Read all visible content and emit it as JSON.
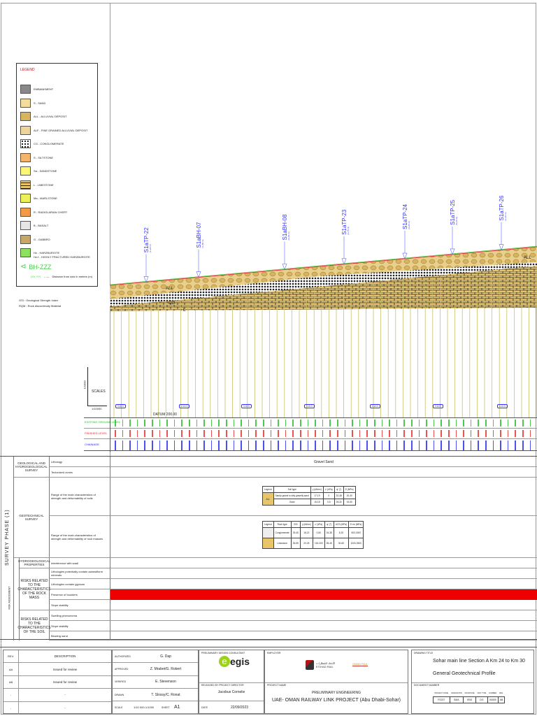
{
  "legend": {
    "title": "LEGEND",
    "items": [
      {
        "label": "EMBANKMENT",
        "color": "#888"
      },
      {
        "label": "S - SAND",
        "color": "#f3dc9c"
      },
      {
        "label": "ALL - ALLUVIAL DEPOSIT",
        "color": "#d9b45e"
      },
      {
        "label": "ALF - FINE GRAINED ALLUVIAL DEPOSIT",
        "color": "#ecd49a"
      },
      {
        "label": "CG - CONGLOMERATE",
        "color": "#ffffff"
      },
      {
        "label": "S - SILTSTONE",
        "color": "#f6b36b"
      },
      {
        "label": "Sa - SANDSTONE",
        "color": "#fbf774"
      },
      {
        "label": "L - LIMESTONE",
        "color": "#e8c56a"
      },
      {
        "label": "Ma - MARLSTONE",
        "color": "#eef05a"
      },
      {
        "label": "R - RADIOLARIAN CHERT",
        "color": "#f39a4a"
      },
      {
        "label": "B - BASALT",
        "color": "#e6e6e6"
      },
      {
        "label": "G - GABBRO",
        "color": "#c8a666"
      },
      {
        "label": "Hz - HARZBURGITE",
        "label2": "Hz-f - HIGHLY FRACTURED HARZBURGITE",
        "color": "#8ee060"
      }
    ],
    "bh_symbol": "BH-ZZZ",
    "bh_note": "Distance from axis in meters (m)",
    "bh_sub": "(XX,YY)",
    "abbr": [
      "GSI : Geological Strength Index",
      "RQM : Rock discontinuity Material"
    ]
  },
  "boreholes": [
    {
      "name": "S1aTP-22",
      "chain": "(1+20 m)"
    },
    {
      "name": "S1aBH-07",
      "chain": "(1+50 m)"
    },
    {
      "name": "S1aBH-08",
      "chain": "(2+60 m)"
    },
    {
      "name": "S1aTP-23",
      "chain": "(3+75 m)"
    },
    {
      "name": "S1aTP-24",
      "chain": "(4+65 m)"
    },
    {
      "name": "S1aTP-25",
      "chain": "(5+40 m)"
    },
    {
      "name": "S1aTP-26",
      "chain": "(6+10 m)"
    }
  ],
  "layer_tags": [
    "ALL",
    "CG",
    "L",
    "ALL"
  ],
  "scales": {
    "label": "SCALES",
    "h": "1/10000",
    "v": "1/1000"
  },
  "datum": "DATUM 200.00",
  "va_label": "V.A.G",
  "bands": {
    "existing": "EXISTING GROUND LEVEL",
    "finished": "FINISHED LEVEL",
    "chainage": "CHAINAGE"
  },
  "table": {
    "phase": "SURVEY PHASE (1)",
    "risk": "RISK ASSESSMENT",
    "groups": [
      "GEOLOGICAL AND HYDROGEOLOGICAL SURVEY",
      "GEOTECHNICAL SURVEY",
      "HYDROGEOLOGICAL PROPERTIES",
      "RISKS RELATED TO THE CHARACTERISTICS OF THE ROCK MASS",
      "RISKS RELATED TO THE CHARACTERISTICS OF THE SOIL"
    ],
    "rows": [
      "Lithology",
      "Tectonized zones",
      "Range of the main characteristics of strength and deformability of soils",
      "Range of the main characteristics of strength and deformability of rock masses",
      "Interference with wadi",
      "Lithologies potentially contain asbestiform minerals",
      "Lithologies contain gypsum",
      "Presence of boulders",
      "Slope stability",
      "Swelling phenomena",
      "Slope stability",
      "Blowing sand"
    ],
    "lithology_value": "Gravel Sand",
    "soil_table": {
      "headers": [
        "Legend",
        "Soil type",
        "γ (kN/m³)",
        "c' (kPa)",
        "φ' (°)",
        "E (MPa)"
      ],
      "rows": [
        [
          "Sandy gravel to silty gravelly sand",
          "17-19",
          "0",
          "32-38",
          "20-40"
        ],
        [
          "Sand",
          "15-18",
          "0-5",
          "28-32",
          "15-50"
        ]
      ],
      "legend_code": "ALL"
    },
    "rock_table": {
      "headers": [
        "Legend",
        "Rock type",
        "GSI",
        "γ (kN/m³)",
        "c' (kPa)",
        "φ' (°)",
        "UCS (MPa)",
        "E rm (MPa)"
      ],
      "rows": [
        [
          "Conglomerate",
          "25-45",
          "18-22",
          "0-50",
          "34-38",
          "5-20",
          "500-1500"
        ],
        [
          "Limestone",
          "35-55",
          "20-25",
          "100-200",
          "35-45",
          "30-60",
          "1000-2500"
        ]
      ]
    }
  },
  "revisions": {
    "headers": [
      "REV.",
      "DESCRIPTION"
    ],
    "rows": [
      [
        "AA",
        "Issued for review"
      ],
      [
        "AB",
        "Issued for review"
      ],
      [
        "-",
        "-"
      ],
      [
        "-",
        "-"
      ]
    ]
  },
  "signoff": [
    [
      "AUTHORIZED",
      "G. Dap"
    ],
    [
      "APPROVED",
      "Z. Mrabet/G. Robert"
    ],
    [
      "VERIFIED",
      "E. Stevenson"
    ],
    [
      "DRAWN",
      "T. Slossy/C. Ronat"
    ]
  ],
  "scale": {
    "label": "SCALE",
    "value": "1/10 000-1/1000",
    "sheet_label": "SHEET",
    "sheet": "A1"
  },
  "consultant": {
    "label": "PRELIMINARY DESIGN CONSULTANT",
    "logo": "egis",
    "released_label": "RELEASED BY PROJECT DIRECTOR",
    "released": "Jacobus Cornelie",
    "date_label": "DATE",
    "date": "22/09/2023"
  },
  "employer": {
    "label": "EMPLOYER",
    "logo1": "ETIHAD RAIL",
    "logo1_ar": "الاتحاد للقطارات",
    "logo2": "OMAN RAIL"
  },
  "project": {
    "label": "PROJECT NAME",
    "line1": "PRELIMINARY ENGINEERING",
    "line2": "UAE- OMAN RAILWAY LINK PROJECT (Abu Dhabi-Sohar)"
  },
  "drawing": {
    "label": "DRAWING TITLE",
    "title1": "Sohar main line Section A Km 24 to Km 30",
    "title2": "General Geotechnical Profile"
  },
  "docnum": {
    "label": "DOCUMENT NUMBER",
    "headers": [
      "PROJECT CODE",
      "ORIGINATOR",
      "DISCIPLINE",
      "DOC TYPE",
      "NUMBER",
      "REV."
    ],
    "values": [
      "P2237",
      "SMA",
      "EBS",
      "DG",
      "00005",
      "AB"
    ]
  }
}
